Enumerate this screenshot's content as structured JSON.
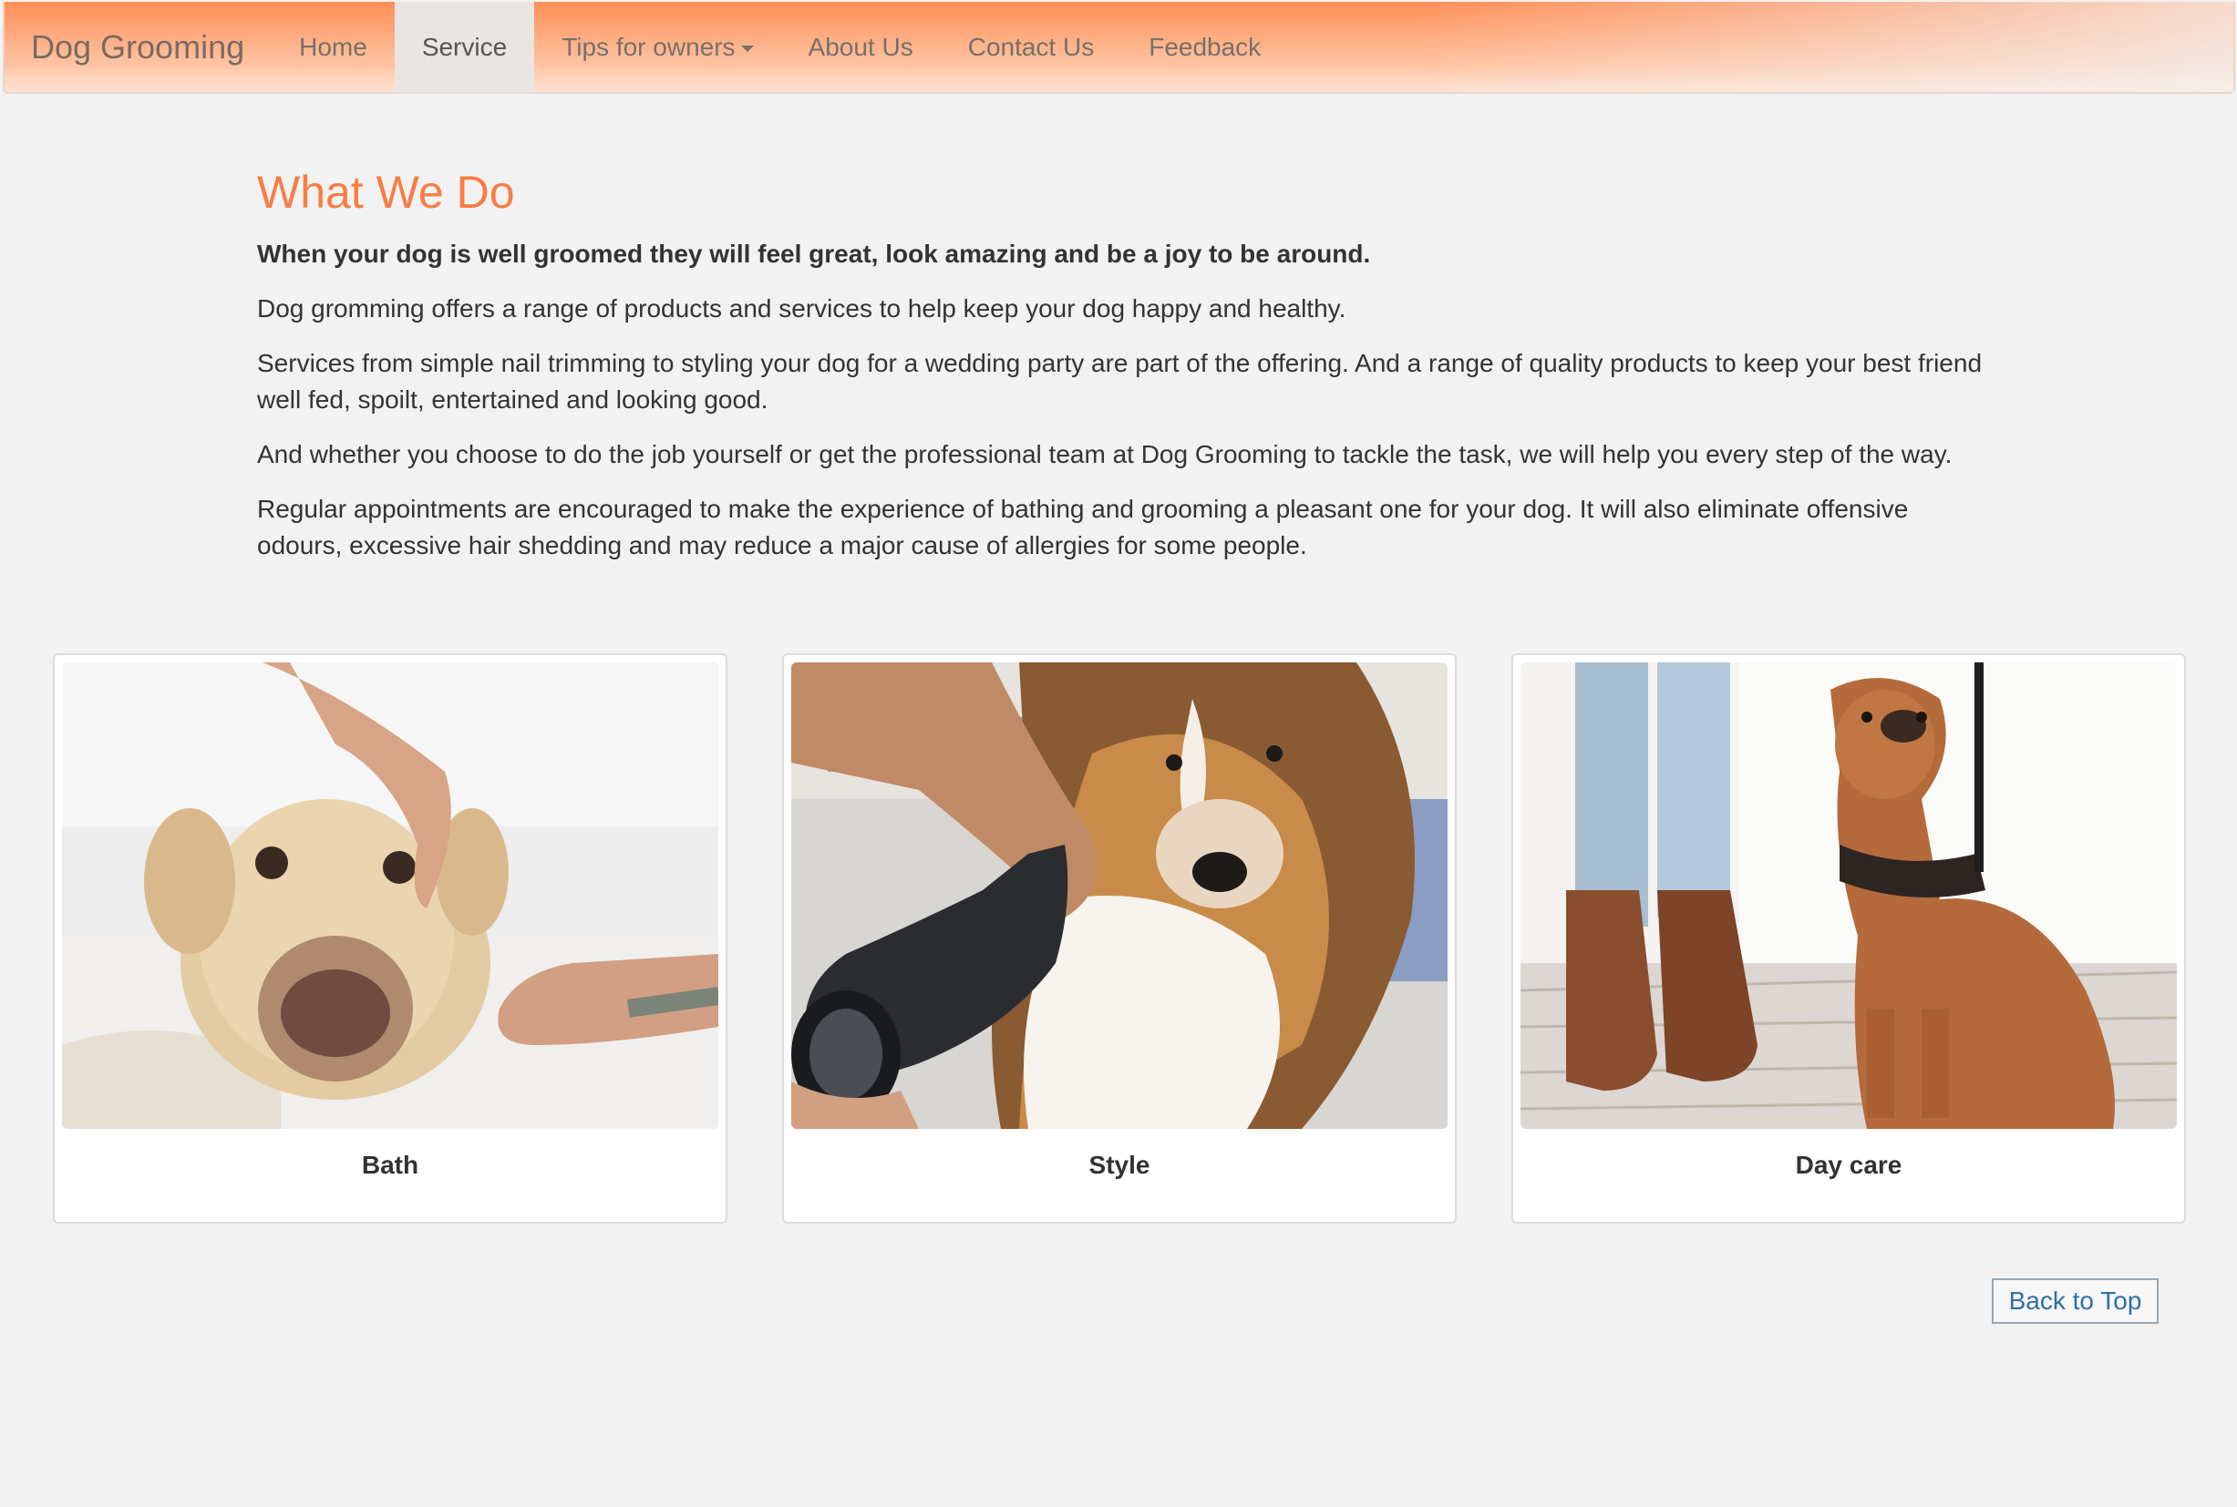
{
  "navbar": {
    "brand": "Dog Grooming",
    "items": [
      {
        "label": "Home"
      },
      {
        "label": "Service",
        "active": true
      },
      {
        "label": "Tips for owners",
        "dropdown": true
      },
      {
        "label": "About Us"
      },
      {
        "label": "Contact Us"
      },
      {
        "label": "Feedback"
      }
    ]
  },
  "main": {
    "title": "What We Do",
    "lead": "When your dog is well groomed they will feel great, look amazing and be a joy to be around.",
    "paragraphs": [
      "Dog gromming offers a range of products and services to help keep your dog happy and healthy.",
      "Services from simple nail trimming to styling your dog for a wedding party are part of the offering. And a range of quality products to keep your best friend well fed, spoilt, entertained and looking good.",
      "And whether you choose to do the job yourself or get the professional team at Dog Grooming to tackle the task, we will help you every step of the way.",
      "Regular appointments are encouraged to make the experience of bathing and grooming a pleasant one for your dog. It will also eliminate offensive odours, excessive hair shedding and may reduce a major cause of allergies for some people."
    ]
  },
  "services": [
    {
      "caption": "Bath",
      "image": "dog-bath-photo"
    },
    {
      "caption": "Style",
      "image": "dog-style-photo"
    },
    {
      "caption": "Day care",
      "image": "dog-daycare-photo"
    }
  ],
  "footer": {
    "back_to_top": "Back to Top"
  },
  "colors": {
    "accent": "#f97d43",
    "navbar_gradient_top": "#ff8e56",
    "link": "#2f6fa8",
    "background": "#f2f2f2"
  }
}
